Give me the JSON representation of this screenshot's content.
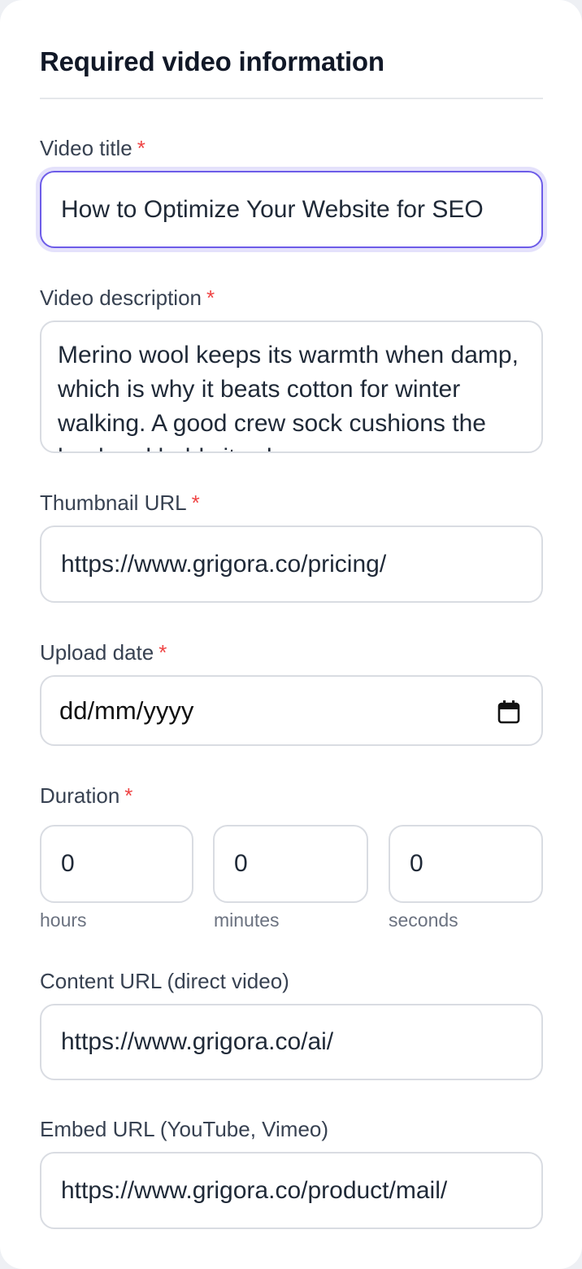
{
  "section": {
    "title": "Required video information"
  },
  "fields": {
    "video_title": {
      "label": "Video title",
      "required_mark": "*",
      "value": "How to Optimize Your Website for SEO"
    },
    "video_description": {
      "label": "Video description",
      "required_mark": "*",
      "value": "Merino wool keeps its warmth when damp, which is why it beats cotton for winter walking. A good crew sock cushions the heel and holds its shape"
    },
    "thumbnail_url": {
      "label": "Thumbnail URL",
      "required_mark": "*",
      "value": "https://www.grigora.co/pricing/"
    },
    "upload_date": {
      "label": "Upload date",
      "required_mark": "*",
      "placeholder": "dd/mm/yyyy",
      "icon": "calendar-icon"
    },
    "duration": {
      "label": "Duration",
      "required_mark": "*",
      "hours": {
        "value": "0",
        "unit": "hours"
      },
      "minutes": {
        "value": "0",
        "unit": "minutes"
      },
      "seconds": {
        "value": "0",
        "unit": "seconds"
      }
    },
    "content_url": {
      "label": "Content URL (direct video)",
      "value": "https://www.grigora.co/ai/"
    },
    "embed_url": {
      "label": "Embed URL (YouTube, Vimeo)",
      "value": "https://www.grigora.co/product/mail/"
    }
  },
  "colors": {
    "accent": "#6d5ce8",
    "required": "#ef4444",
    "border": "#d9dce2",
    "label": "#374151"
  }
}
